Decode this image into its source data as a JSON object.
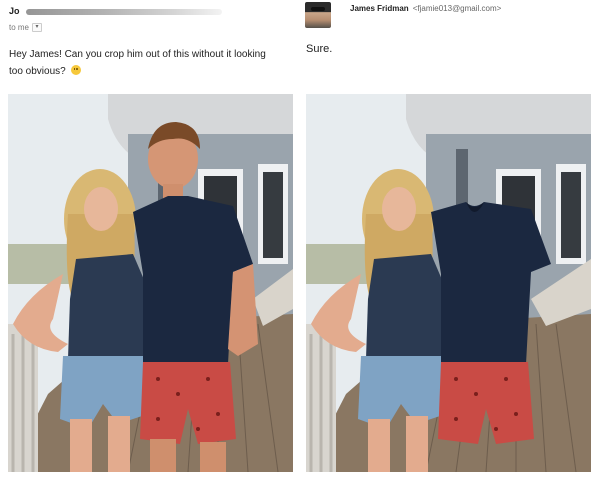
{
  "left_email": {
    "sender_name": "Jo",
    "to_line": "to me",
    "caret": "▾",
    "message": "Hey James! Can you crop him out of this without it looking too obvious?",
    "emoji": "smile-emoji"
  },
  "right_email": {
    "sender_name": "James Fridman",
    "sender_email": "<fjamie013@gmail.com>",
    "reply": "Sure."
  },
  "photos": {
    "original": "couple-on-porch-photo",
    "edited": "headless-shirt-photo"
  }
}
